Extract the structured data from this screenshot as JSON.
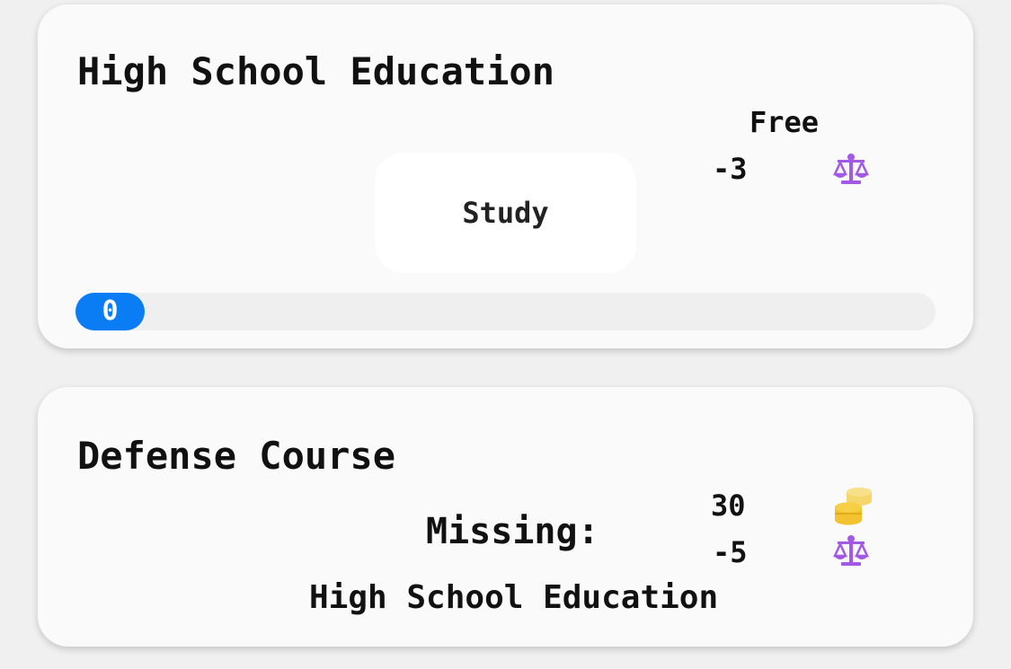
{
  "courses": [
    {
      "title": "High School Education",
      "price": "Free",
      "happiness_cost": "-3",
      "action_label": "Study",
      "progress_value": "0",
      "progress_fraction": 0.0
    },
    {
      "title": "Defense Course",
      "money_cost": "30",
      "happiness_cost": "-5",
      "missing_label": "Missing:",
      "missing_requirement": "High School Education"
    }
  ],
  "colors": {
    "accent": "#0a7cf4",
    "karma_icon": "#a259e6",
    "coin_icon": "#f2c230",
    "card_bg": "#fafafa",
    "page_bg": "#f0f0f0"
  },
  "icons": {
    "karma": "balance-scale-icon",
    "money": "coins-icon"
  }
}
